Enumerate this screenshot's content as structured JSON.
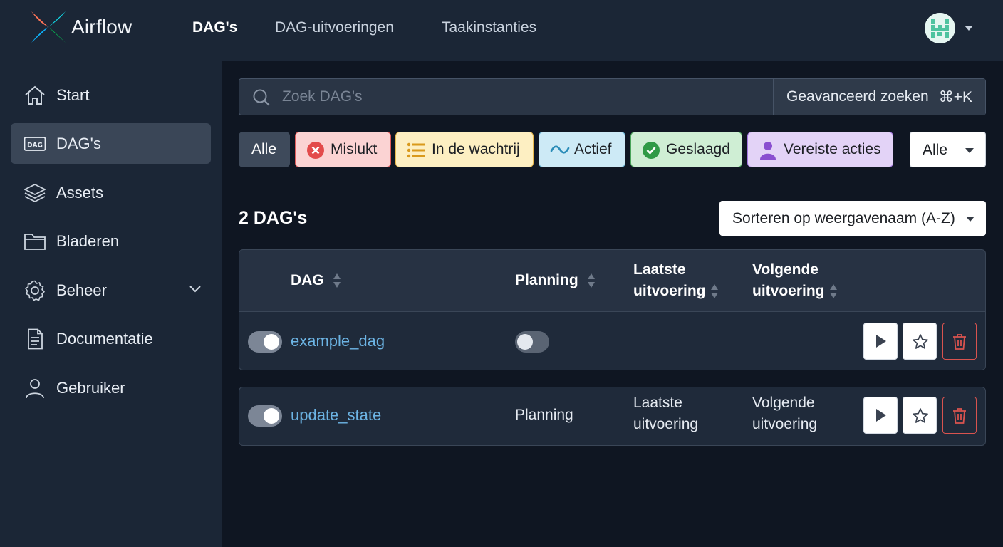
{
  "header": {
    "brand": "Airflow",
    "nav": [
      {
        "label": "DAG's",
        "active": true
      },
      {
        "label": "DAG-uitvoeringen",
        "active": false
      },
      {
        "label": "Taakinstanties",
        "active": false
      }
    ],
    "avatar_icon": "user-avatar-icon"
  },
  "sidebar": {
    "items": [
      {
        "label": "Start",
        "icon": "home-icon",
        "active": false
      },
      {
        "label": "DAG's",
        "icon": "dag-icon",
        "active": true
      },
      {
        "label": "Assets",
        "icon": "layers-icon",
        "active": false
      },
      {
        "label": "Bladeren",
        "icon": "folder-icon",
        "active": false
      },
      {
        "label": "Beheer",
        "icon": "gear-icon",
        "active": false
      },
      {
        "label": "Documentatie",
        "icon": "document-icon",
        "active": false
      },
      {
        "label": "Gebruiker",
        "icon": "user-icon",
        "active": false
      }
    ]
  },
  "search": {
    "placeholder": "Zoek DAG's",
    "value": "",
    "advanced_label": "Geavanceerd zoeken",
    "shortcut": "⌘+K"
  },
  "filters": {
    "chips": [
      {
        "label": "Alle",
        "icon": null
      },
      {
        "label": "Mislukt",
        "icon": "x-circle-icon",
        "color": "#e34b4b"
      },
      {
        "label": "In de wachtrij",
        "icon": "list-icon",
        "color": "#d99a1c"
      },
      {
        "label": "Actief",
        "icon": "wave-icon",
        "color": "#2a8cb8"
      },
      {
        "label": "Geslaagd",
        "icon": "check-circle-icon",
        "color": "#2f9a46"
      },
      {
        "label": "Vereiste acties",
        "icon": "person-icon",
        "color": "#8a4fd0"
      }
    ],
    "select_value": "Alle"
  },
  "results": {
    "count_label": "2 DAG's",
    "sort_value": "Sorteren op weergavenaam (A-Z)"
  },
  "table": {
    "columns": {
      "dag": "DAG",
      "schedule": "Planning",
      "last_run_1": "Laatste",
      "last_run_2": "uitvoering",
      "next_run_1": "Volgende",
      "next_run_2": "uitvoering"
    },
    "rows": [
      {
        "enabled": true,
        "dag_id": "example_dag",
        "schedule_toggle": false,
        "schedule": "",
        "last_run_1": "",
        "last_run_2": "",
        "next_run_1": "",
        "next_run_2": ""
      },
      {
        "enabled": true,
        "dag_id": "update_state",
        "schedule": "Planning",
        "last_run_1": "Laatste",
        "last_run_2": "uitvoering",
        "next_run_1": "Volgende",
        "next_run_2": "uitvoering"
      }
    ]
  },
  "colors": {
    "background": "#0f1622",
    "panel": "#1b2636",
    "link": "#6cb4e4",
    "delete": "#d9534f"
  }
}
